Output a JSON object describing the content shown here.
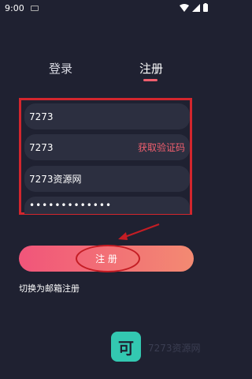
{
  "status_bar": {
    "time": "9:00"
  },
  "tabs": [
    {
      "label": "登录"
    },
    {
      "label": "注册"
    }
  ],
  "form": {
    "phone_value": "7273",
    "code_value": "7273",
    "code_button": "获取验证码",
    "nickname_value": "7273资源网",
    "password_value": "•••••••••••••"
  },
  "submit_label": "注 册",
  "switch_label": "切换为邮箱注册",
  "logo_text": "可",
  "watermark": "7273资源网",
  "colors": {
    "accent": "#f05f6e",
    "background": "#1f2131",
    "field": "#2c2f40",
    "highlight": "#d3262d",
    "logo": "#33c8b1"
  }
}
